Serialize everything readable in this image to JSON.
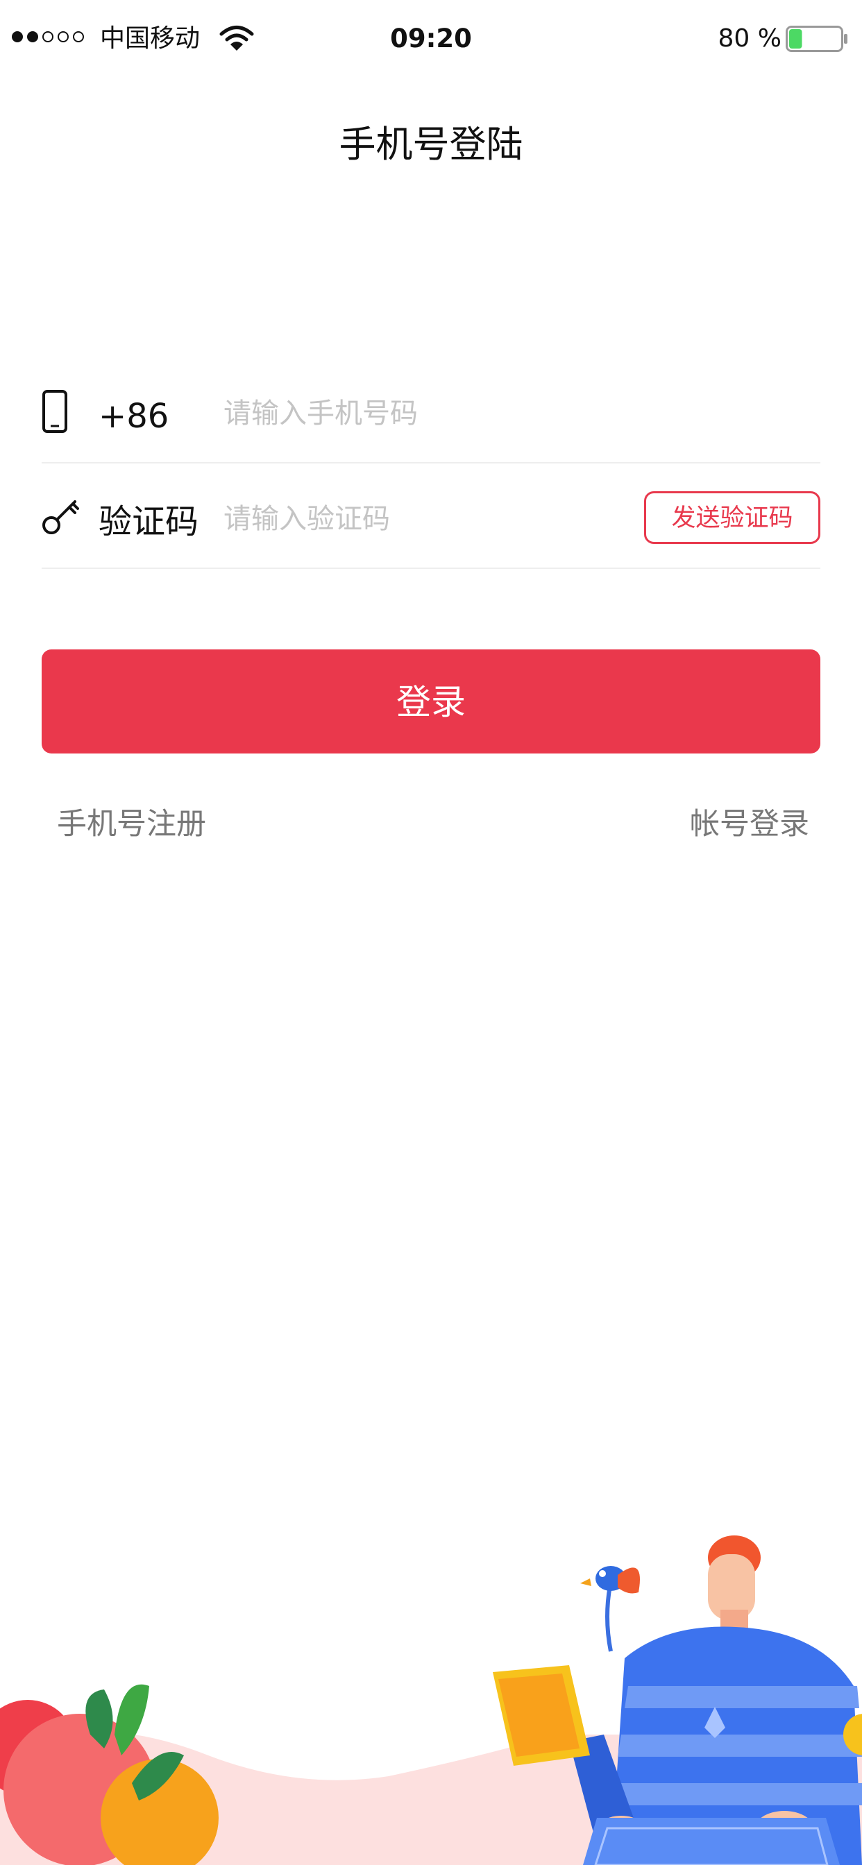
{
  "status_bar": {
    "carrier": "中国移动",
    "time": "09:20",
    "battery_percent": "80 %",
    "battery_level": 0.25,
    "signal_bars_filled": 2,
    "signal_bars_total": 5
  },
  "page": {
    "title": "手机号登陆"
  },
  "form": {
    "phone_prefix": "+86",
    "phone_placeholder": "请输入手机号码",
    "code_label": "验证码",
    "code_placeholder": "请输入验证码",
    "send_code_label": "发送验证码"
  },
  "actions": {
    "login_label": "登录",
    "register_link": "手机号注册",
    "account_login_link": "帐号登录"
  },
  "colors": {
    "accent": "#ea384c",
    "battery_fill": "#4cd964"
  },
  "icons": {
    "phone_row": "mobile-phone-icon",
    "code_row": "key-icon",
    "wifi": "wifi-icon",
    "battery": "battery-icon"
  }
}
